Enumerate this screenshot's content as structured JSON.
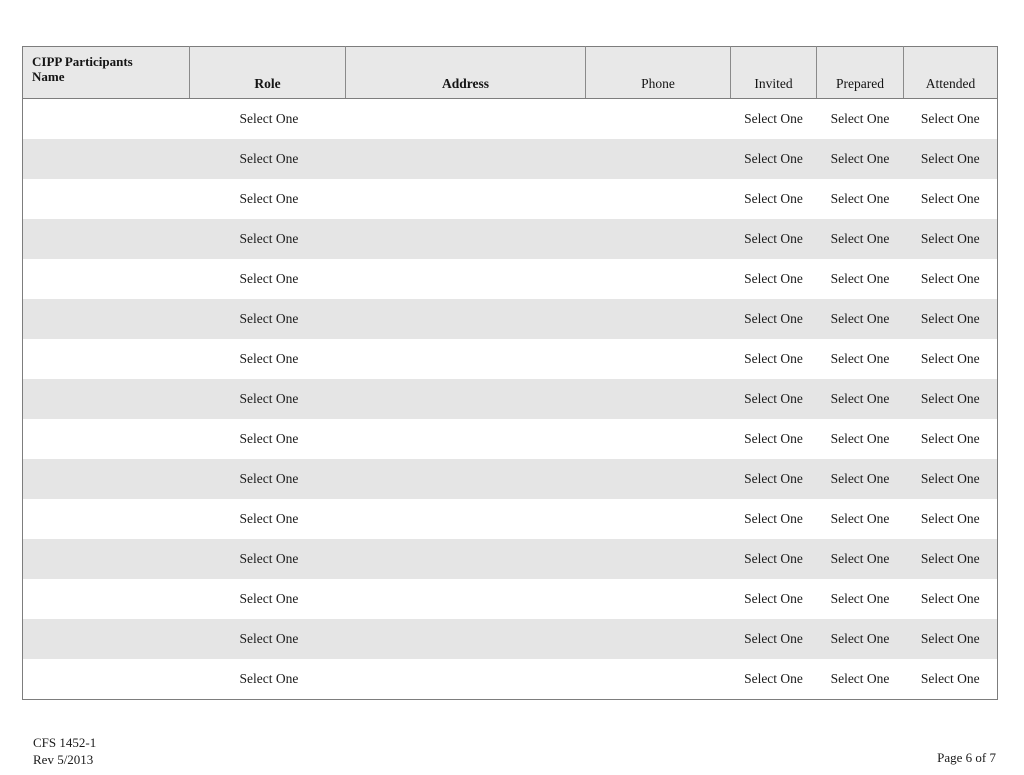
{
  "document": {
    "form_number": "CFS 1452-1",
    "revision": "Rev 5/2013",
    "page_label": "Page 6 of 7"
  },
  "table": {
    "columns": [
      {
        "key": "name",
        "label_line1": "CIPP Participants",
        "label_line2": "Name",
        "style": "bold-left"
      },
      {
        "key": "role",
        "label": "Role",
        "style": "bold-center"
      },
      {
        "key": "address",
        "label": "Address",
        "style": "bold-center"
      },
      {
        "key": "phone",
        "label": "Phone",
        "style": "plain-center"
      },
      {
        "key": "invited",
        "label": "Invited",
        "style": "plain-center"
      },
      {
        "key": "prepared",
        "label": "Prepared",
        "style": "plain-center"
      },
      {
        "key": "attended",
        "label": "Attended",
        "style": "plain-center"
      }
    ],
    "select_placeholder": "Select One",
    "row_count": 15,
    "rows": [
      {
        "name": "",
        "role": "Select One",
        "address": "",
        "phone": "",
        "invited": "Select One",
        "prepared": "Select One",
        "attended": "Select One"
      },
      {
        "name": "",
        "role": "Select One",
        "address": "",
        "phone": "",
        "invited": "Select One",
        "prepared": "Select One",
        "attended": "Select One"
      },
      {
        "name": "",
        "role": "Select One",
        "address": "",
        "phone": "",
        "invited": "Select One",
        "prepared": "Select One",
        "attended": "Select One"
      },
      {
        "name": "",
        "role": "Select One",
        "address": "",
        "phone": "",
        "invited": "Select One",
        "prepared": "Select One",
        "attended": "Select One"
      },
      {
        "name": "",
        "role": "Select One",
        "address": "",
        "phone": "",
        "invited": "Select One",
        "prepared": "Select One",
        "attended": "Select One"
      },
      {
        "name": "",
        "role": "Select One",
        "address": "",
        "phone": "",
        "invited": "Select One",
        "prepared": "Select One",
        "attended": "Select One"
      },
      {
        "name": "",
        "role": "Select One",
        "address": "",
        "phone": "",
        "invited": "Select One",
        "prepared": "Select One",
        "attended": "Select One"
      },
      {
        "name": "",
        "role": "Select One",
        "address": "",
        "phone": "",
        "invited": "Select One",
        "prepared": "Select One",
        "attended": "Select One"
      },
      {
        "name": "",
        "role": "Select One",
        "address": "",
        "phone": "",
        "invited": "Select One",
        "prepared": "Select One",
        "attended": "Select One"
      },
      {
        "name": "",
        "role": "Select One",
        "address": "",
        "phone": "",
        "invited": "Select One",
        "prepared": "Select One",
        "attended": "Select One"
      },
      {
        "name": "",
        "role": "Select One",
        "address": "",
        "phone": "",
        "invited": "Select One",
        "prepared": "Select One",
        "attended": "Select One"
      },
      {
        "name": "",
        "role": "Select One",
        "address": "",
        "phone": "",
        "invited": "Select One",
        "prepared": "Select One",
        "attended": "Select One"
      },
      {
        "name": "",
        "role": "Select One",
        "address": "",
        "phone": "",
        "invited": "Select One",
        "prepared": "Select One",
        "attended": "Select One"
      },
      {
        "name": "",
        "role": "Select One",
        "address": "",
        "phone": "",
        "invited": "Select One",
        "prepared": "Select One",
        "attended": "Select One"
      },
      {
        "name": "",
        "role": "Select One",
        "address": "",
        "phone": "",
        "invited": "Select One",
        "prepared": "Select One",
        "attended": "Select One"
      }
    ]
  },
  "colors": {
    "header_background": "#e8e8e8",
    "stripe_background": "#e5e5e5",
    "row_background": "#ffffff",
    "border": "#7d7d7d",
    "text": "#1a1a1a"
  }
}
